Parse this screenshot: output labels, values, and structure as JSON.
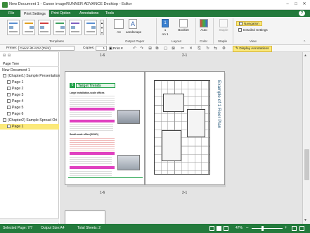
{
  "window": {
    "title": "New Document 1 - Canon imageRUNNER ADVANCE Desktop - Editor"
  },
  "tabs": [
    "File",
    "Print Settings",
    "Print Option",
    "Annotations",
    "Tools"
  ],
  "active_tab": "Print Settings",
  "ribbon": {
    "templates_label": "Templates",
    "output_paper": {
      "size": "A4",
      "orientation": "Landscape",
      "label": "Output Paper"
    },
    "layout": {
      "pages": "1",
      "pages_sub": "on 1",
      "binding": "Booklet",
      "label": "Layout"
    },
    "color": {
      "mode": "Auto",
      "label": "Color"
    },
    "staple": {
      "value": "Staple",
      "label": "Staple"
    },
    "view": {
      "navigation": "Navigation",
      "detailed": "Detailed Settings",
      "label": "View"
    }
  },
  "toolbar": {
    "printer_label": "Printer:",
    "printer_value": "Canon iR-ADV (Print)",
    "copies_label": "Copies:",
    "copies_value": "1",
    "print_label": "Print",
    "display_annotations": "Display Annotations"
  },
  "page_tree": {
    "title": "Page Tree",
    "items": [
      {
        "label": "New Document 1",
        "level": 0
      },
      {
        "label": "(Chapter1) Sample Presentation",
        "level": 1
      },
      {
        "label": "Page 1",
        "level": 2
      },
      {
        "label": "Page 2",
        "level": 2
      },
      {
        "label": "Page 3",
        "level": 2
      },
      {
        "label": "Page 4",
        "level": 2
      },
      {
        "label": "Page 5",
        "level": 2
      },
      {
        "label": "Page 6",
        "level": 2
      },
      {
        "label": "(Chapter2) Sample Spread Ori",
        "level": 1
      },
      {
        "label": "Page 1",
        "level": 2
      }
    ]
  },
  "workspace": {
    "top_left_label": "1-6",
    "top_right_label": "2-1",
    "bottom_left_label": "1-6",
    "bottom_right_label": "2-1",
    "left_page": {
      "heading_num": "6",
      "heading": "Target Trends",
      "section1": "Large installation-scale offices",
      "section2": "Small-scale office(SOHO)"
    },
    "right_page": {
      "title": "Example of 1 Floor Plan"
    }
  },
  "status": {
    "selected_pages": "Selected Page: 7/7",
    "output_size": "Output Size:A4",
    "total_sheets": "Total Sheets: 2",
    "zoom": "47%"
  },
  "colors": {
    "brand_green": "#237a3c",
    "highlight": "#fbe97a",
    "heading_green": "#22a24a"
  }
}
